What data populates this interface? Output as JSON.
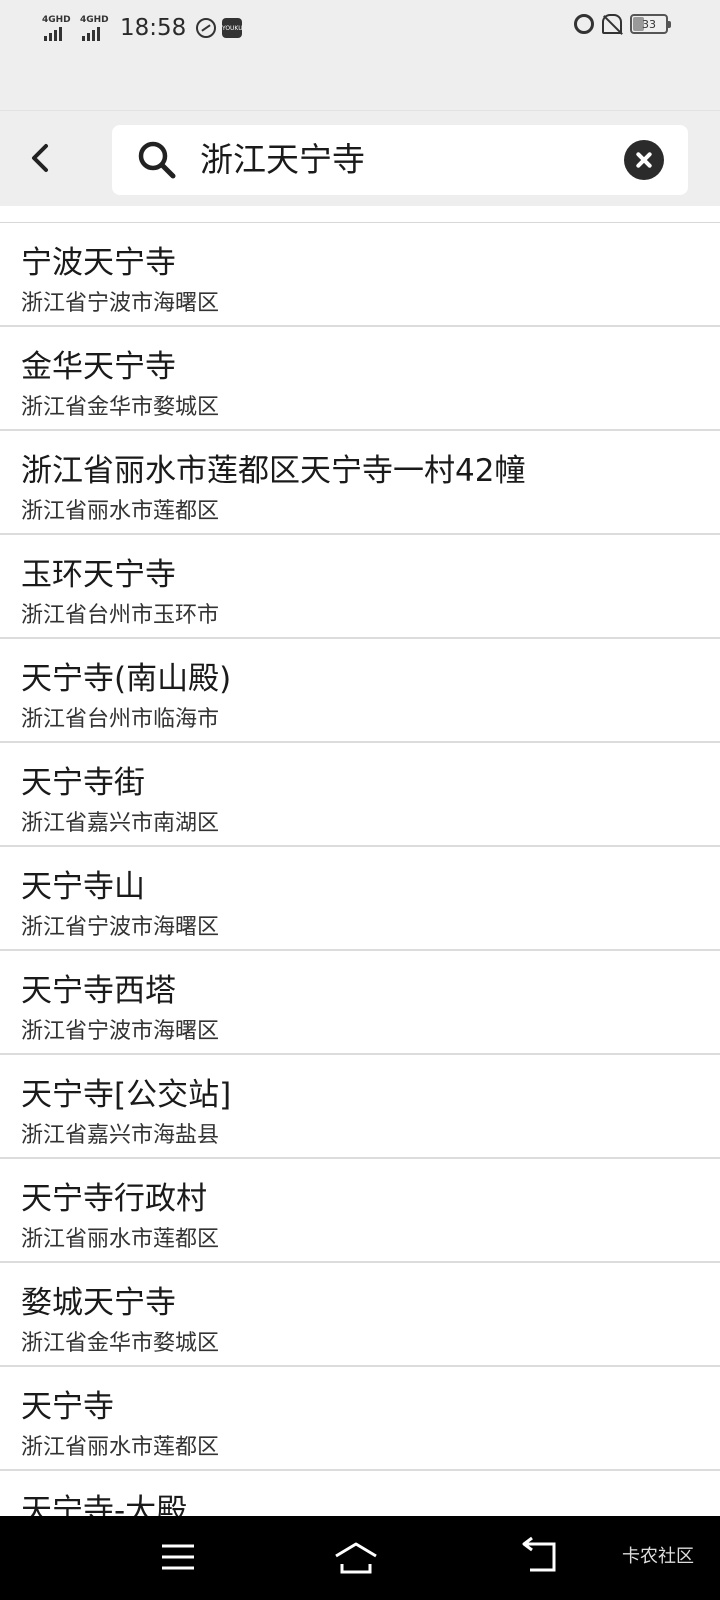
{
  "status_bar": {
    "network_1": "4GHD",
    "network_2": "4GHD",
    "time": "18:58",
    "app_icon": "youku-icon",
    "battery": "33"
  },
  "search": {
    "query": "浙江天宁寺"
  },
  "results": [
    {
      "name": "宁波天宁寺",
      "address": "浙江省宁波市海曙区"
    },
    {
      "name": "金华天宁寺",
      "address": "浙江省金华市婺城区"
    },
    {
      "name": "浙江省丽水市莲都区天宁寺一村42幢",
      "address": "浙江省丽水市莲都区"
    },
    {
      "name": "玉环天宁寺",
      "address": "浙江省台州市玉环市"
    },
    {
      "name": "天宁寺(南山殿)",
      "address": "浙江省台州市临海市"
    },
    {
      "name": "天宁寺街",
      "address": "浙江省嘉兴市南湖区"
    },
    {
      "name": "天宁寺山",
      "address": "浙江省宁波市海曙区"
    },
    {
      "name": "天宁寺西塔",
      "address": "浙江省宁波市海曙区"
    },
    {
      "name": "天宁寺[公交站]",
      "address": "浙江省嘉兴市海盐县"
    },
    {
      "name": "天宁寺行政村",
      "address": "浙江省丽水市莲都区"
    },
    {
      "name": "婺城天宁寺",
      "address": "浙江省金华市婺城区"
    },
    {
      "name": "天宁寺",
      "address": "浙江省丽水市莲都区"
    },
    {
      "name": "天宁寺-大殿",
      "address": ""
    }
  ],
  "watermark": "卡农社区"
}
